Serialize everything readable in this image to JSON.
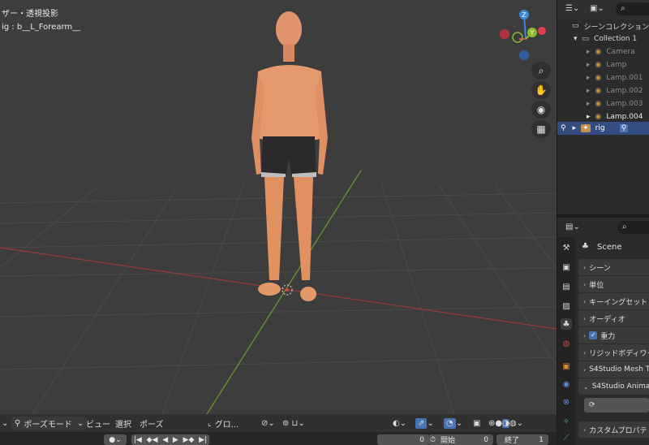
{
  "viewport": {
    "view_label": "ザー・透視投影",
    "object_label": "ig : b__L_Forearm__",
    "gizmo": {
      "z": "Z",
      "y": "Y",
      "x_color": "#e2404f",
      "y_color": "#8bbb2c",
      "z_color": "#3d87d8"
    },
    "nav_icons": [
      "zoom-icon",
      "hand-icon",
      "camera-icon",
      "grid-icon"
    ]
  },
  "header": {
    "mode": "ポーズモード",
    "menus": [
      "ビュー",
      "選択",
      "ポーズ"
    ],
    "transform": "グロ..."
  },
  "timeline": {
    "current_frame": "0",
    "start_label": "開始",
    "start_value": "0",
    "end_label": "終了",
    "end_value": "1"
  },
  "outliner": {
    "scene_collection": "シーンコレクション",
    "collection": "Collection 1",
    "items": [
      "Camera",
      "Lamp",
      "Lamp.001",
      "Lamp.002",
      "Lamp.003",
      "Lamp.004"
    ],
    "rig": "rig"
  },
  "properties": {
    "scene_name": "Scene",
    "panels": [
      "シーン",
      "単位",
      "キーイングセット",
      "オーディオ",
      "重力",
      "リジッドボディワー",
      "S4Studio Mesh T",
      "S4Studio Animat",
      "カスタムプロパテ"
    ]
  },
  "colors": {
    "selected": "#334d80",
    "accent": "#4772b3",
    "background": "#3d3d3d"
  }
}
